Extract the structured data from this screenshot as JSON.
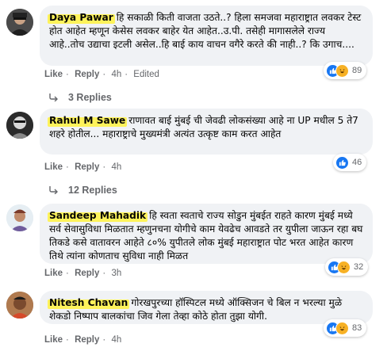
{
  "comments": [
    {
      "author": "Daya Pawar",
      "text": "हि सकाळी किती वाजता उठते..? हिला समजवा महाराष्ट्रात लवकर टेस्ट होत आहेत म्हणून केसेस लवकर बाहेर येत आहेत..उ.पी. तसेही मागासलेले राज्य आहे..तोच उद्याचा इटली असेल..हि बाई काय वाचन वगैरे करते की नाही..? कि उगाच....",
      "like": "Like",
      "reply": "Reply",
      "time": "4h",
      "edited": "Edited",
      "reaction_count": "89",
      "replies_label": "3 Replies"
    },
    {
      "author": "Rahul M Sawe",
      "text": "राणावत बाई मुंबई ची जेवढी लोकसंख्या आहे ना UP मधील 5 ते7 शहरे होतील... महाराष्ट्राचे मुख्यमंत्री अत्यंत उत्कृष्ट काम करत आहेत",
      "like": "Like",
      "reply": "Reply",
      "time": "4h",
      "reaction_count": "46",
      "replies_label": "12 Replies"
    },
    {
      "author": "Sandeep Mahadik",
      "text": "हि स्वता स्वताचे राज्य सोडुन मुंबईत राहते कारण मुंबई मध्ये सर्व सेवासुविधा मिळतात म्हणुनचना योगीचे काम येवढेच आवडते तर युपीला जाऊन रहा बघ तिकडे कसे वातावरन आहेते ८०% युपीतले लोक मुंबई महाराष्ट्रात पोट भरत आहेत कारण तिथे त्यांना कोणताच सुविधा नाही मिळत",
      "like": "Like",
      "reply": "Reply",
      "time": "3h",
      "reaction_count": "32"
    },
    {
      "author": "Nitesh Chavan",
      "text": "गोरखपुरच्या हॉस्पिटल मध्ये ऑक्सिजन चे बिल न भरल्या मुळे शेकडो निष्पाप बालकांचा जिव गेला तेव्हा कोठे होता तुझा योगी.",
      "like": "Like",
      "reply": "Reply",
      "time": "4h",
      "reaction_count": "83"
    }
  ],
  "colors": {
    "bubble": "#f0f2f5",
    "meta": "#65676b",
    "like_blue": "#1877f2",
    "haha_yellow": "#f7b125",
    "name_highlight": "#fff34d"
  }
}
